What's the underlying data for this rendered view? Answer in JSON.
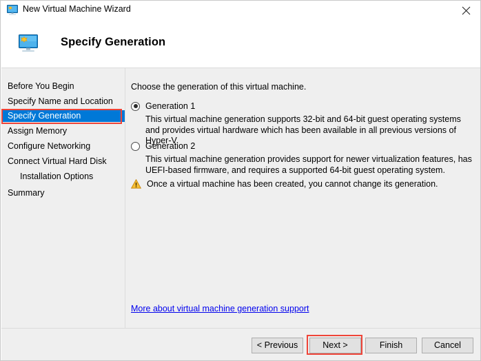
{
  "window": {
    "title": "New Virtual Machine Wizard",
    "title_icon": "virtual-machine-monitor-icon",
    "close_label": "✕"
  },
  "header": {
    "icon": "virtual-machine-monitor-icon",
    "title": "Specify Generation"
  },
  "sidebar": {
    "items": [
      {
        "label": "Before You Begin",
        "selected": false,
        "indented": false
      },
      {
        "label": "Specify Name and Location",
        "selected": false,
        "indented": false
      },
      {
        "label": "Specify Generation",
        "selected": true,
        "indented": false
      },
      {
        "label": "Assign Memory",
        "selected": false,
        "indented": false
      },
      {
        "label": "Configure Networking",
        "selected": false,
        "indented": false
      },
      {
        "label": "Connect Virtual Hard Disk",
        "selected": false,
        "indented": false
      },
      {
        "label": "Installation Options",
        "selected": false,
        "indented": true
      },
      {
        "label": "Summary",
        "selected": false,
        "indented": false
      }
    ]
  },
  "content": {
    "intro": "Choose the generation of this virtual machine.",
    "options": [
      {
        "label": "Generation 1",
        "checked": true,
        "description": "This virtual machine generation supports 32-bit and 64-bit guest operating systems and provides virtual hardware which has been available in all previous versions of Hyper-V."
      },
      {
        "label": "Generation 2",
        "checked": false,
        "description": "This virtual machine generation provides support for newer virtualization features, has UEFI-based firmware, and requires a supported 64-bit guest operating system."
      }
    ],
    "warning": {
      "icon": "warning-triangle-icon",
      "text": "Once a virtual machine has been created, you cannot change its generation."
    },
    "link": "More about virtual machine generation support"
  },
  "footer": {
    "previous_label": "< Previous",
    "next_label": "Next >",
    "finish_label": "Finish",
    "cancel_label": "Cancel"
  },
  "colors": {
    "selection_blue": "#0078d7",
    "annotation_red": "#ef4438",
    "link_blue": "#0000ee",
    "panel_gray": "#efefef",
    "warning_yellow": "#f5b825"
  }
}
